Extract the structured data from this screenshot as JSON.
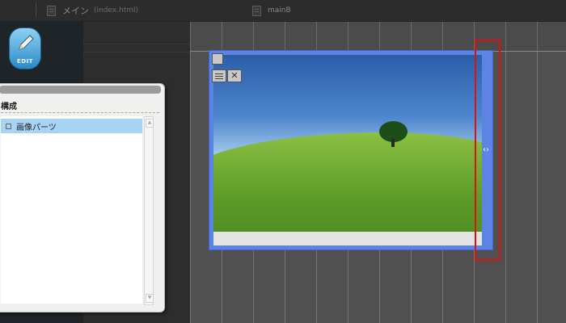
{
  "tabs": [
    {
      "title": "メイン",
      "file": "(index.html)"
    },
    {
      "title": "mainB",
      "file": ""
    }
  ],
  "edit_button": {
    "label": "EDIT"
  },
  "panel": {
    "title": "構成",
    "items": [
      {
        "label": "画像パーツ"
      }
    ]
  },
  "image_part": {
    "caption": ""
  },
  "resize_handle": {
    "glyph": "‹›"
  },
  "colors": {
    "selection": "#5d84e2",
    "highlight": "#dd1111",
    "list_selected": "#a7d3f5"
  }
}
